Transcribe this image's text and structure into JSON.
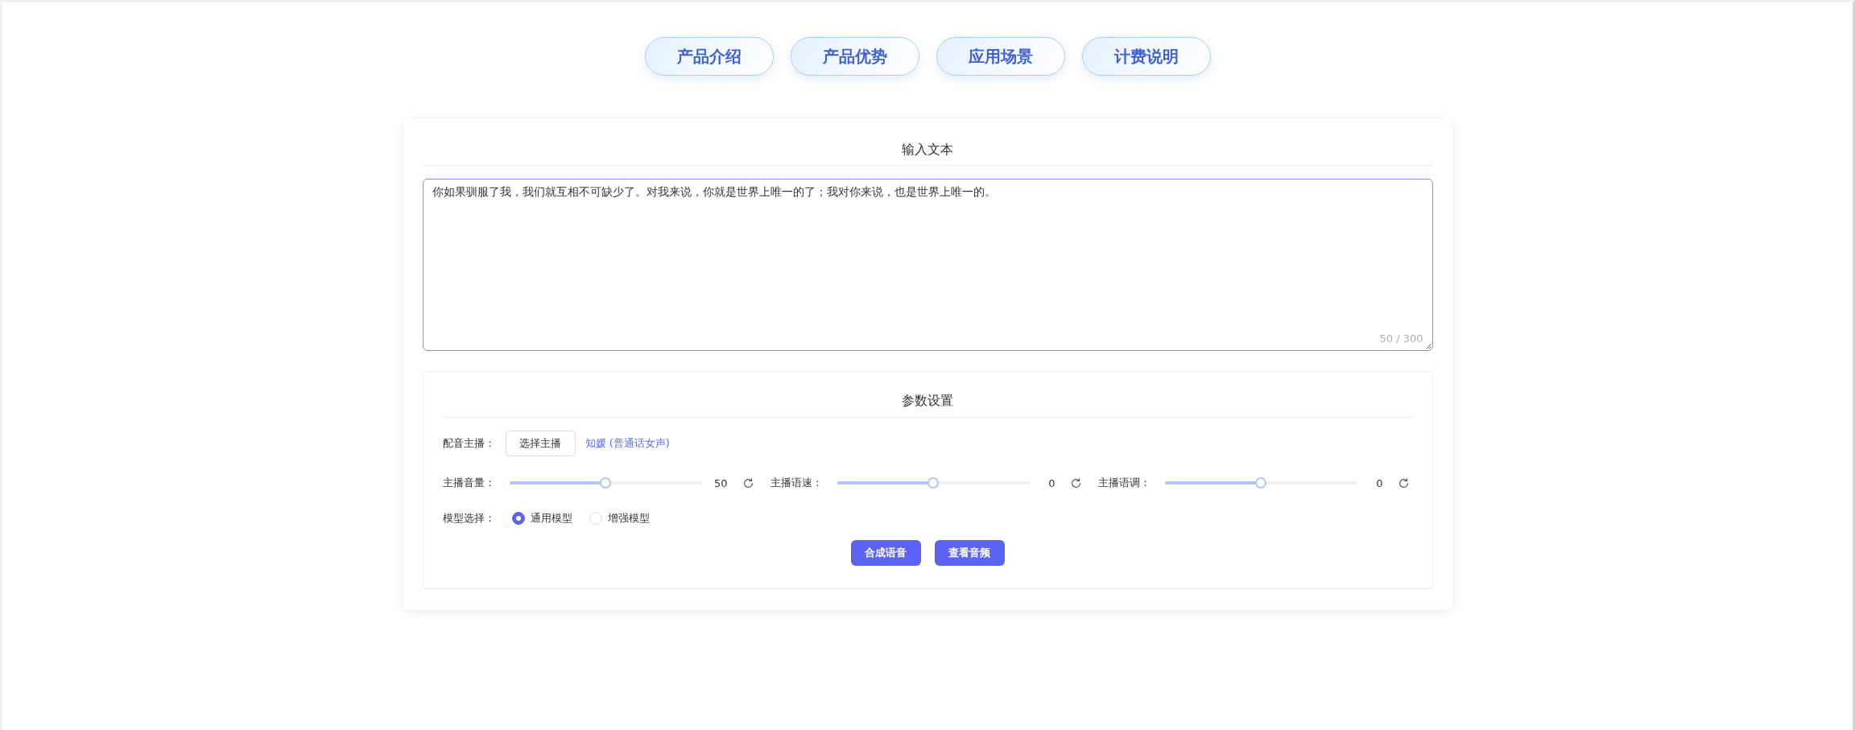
{
  "nav": [
    {
      "label": "产品介绍"
    },
    {
      "label": "产品优势"
    },
    {
      "label": "应用场景"
    },
    {
      "label": "计费说明"
    }
  ],
  "input": {
    "title": "输入文本",
    "text": "你如果驯服了我，我们就互相不可缺少了。对我来说，你就是世界上唯一的了；我对你来说，也是世界上唯一的。",
    "counter": "50 / 300",
    "focused": true
  },
  "settings": {
    "title": "参数设置",
    "voice": {
      "label": "配音主播：",
      "button": "选择主播",
      "selected_voice": "知媛 (普通话女声)"
    },
    "sliders": [
      {
        "label": "主播音量：",
        "level": 0.5,
        "reading": "50"
      },
      {
        "label": "主播语速：",
        "level": 0.5,
        "reading": "0"
      },
      {
        "label": "主播语调：",
        "level": 0.5,
        "reading": "0"
      }
    ],
    "model": {
      "label": "模型选择：",
      "options": [
        {
          "label": "通用模型",
          "selected": true
        },
        {
          "label": "增强模型",
          "selected": false
        }
      ]
    },
    "actions": [
      {
        "label": "合成语音"
      },
      {
        "label": "查看音频"
      }
    ]
  }
}
